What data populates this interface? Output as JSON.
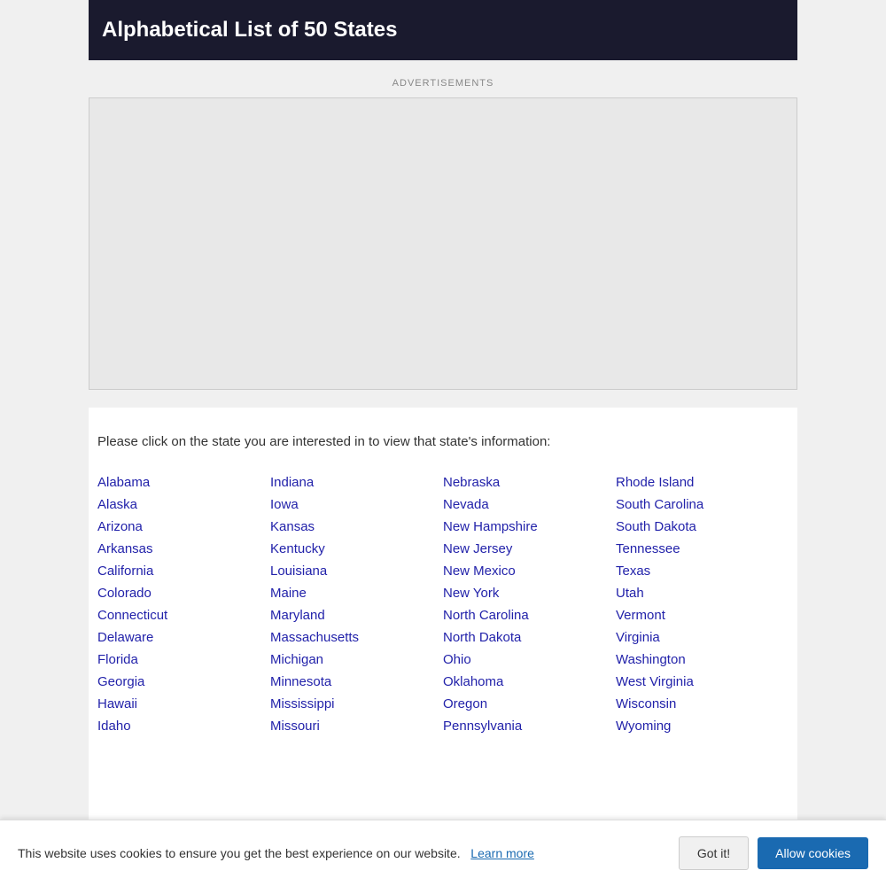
{
  "header": {
    "title": "Alphabetical List of 50 States"
  },
  "ads": {
    "label": "ADVERTISEMENTS"
  },
  "intro": {
    "text": "Please click on the state you are interested in to view that state's information:"
  },
  "columns": [
    {
      "states": [
        "Alabama",
        "Alaska",
        "Arizona",
        "Arkansas",
        "California",
        "Colorado",
        "Connecticut",
        "Delaware",
        "Florida",
        "Georgia",
        "Hawaii",
        "Idaho"
      ]
    },
    {
      "states": [
        "Indiana",
        "Iowa",
        "Kansas",
        "Kentucky",
        "Louisiana",
        "Maine",
        "Maryland",
        "Massachusetts",
        "Michigan",
        "Minnesota",
        "Mississippi",
        "Missouri"
      ]
    },
    {
      "states": [
        "Nebraska",
        "Nevada",
        "New Hampshire",
        "New Jersey",
        "New Mexico",
        "New York",
        "North Carolina",
        "North Dakota",
        "Ohio",
        "Oklahoma",
        "Oregon",
        "Pennsylvania"
      ]
    },
    {
      "states": [
        "Rhode Island",
        "South Carolina",
        "South Dakota",
        "Tennessee",
        "Texas",
        "Utah",
        "Vermont",
        "Virginia",
        "Washington",
        "West Virginia",
        "Wisconsin",
        "Wyoming"
      ]
    }
  ],
  "cookie_banner": {
    "text": "This website uses cookies to ensure you get the best experience on our website.",
    "learn_more": "Learn more",
    "got_it": "Got it!",
    "allow_cookies": "Allow cookies"
  }
}
